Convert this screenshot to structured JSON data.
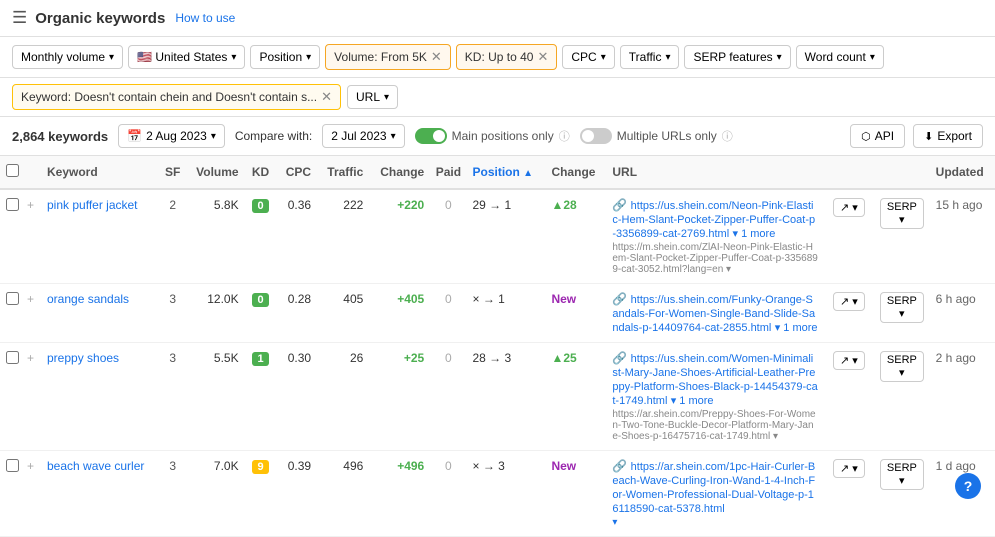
{
  "header": {
    "menu_icon": "≡",
    "title": "Organic keywords",
    "help_label": "How to use"
  },
  "filters": {
    "row1": [
      {
        "label": "Monthly volume",
        "type": "dropdown"
      },
      {
        "label": "United States",
        "type": "dropdown",
        "flag": "🇺🇸"
      },
      {
        "label": "Position",
        "type": "dropdown"
      },
      {
        "label": "Volume: From 5K",
        "type": "tag-active",
        "removable": true
      },
      {
        "label": "KD: Up to 40",
        "type": "tag-active",
        "removable": true
      },
      {
        "label": "CPC",
        "type": "dropdown"
      },
      {
        "label": "Traffic",
        "type": "dropdown"
      },
      {
        "label": "SERP features",
        "type": "dropdown"
      },
      {
        "label": "Word count",
        "type": "dropdown"
      }
    ],
    "row2": {
      "keyword_filter": "Keyword: Doesn't contain chein and Doesn't contain s...",
      "url_btn": "URL"
    }
  },
  "toolbar": {
    "keyword_count": "2,864 keywords",
    "calendar_icon": "📅",
    "date": "2 Aug 2023",
    "compare_label": "Compare with:",
    "compare_date": "2 Jul 2023",
    "main_positions_label": "Main positions only",
    "multiple_urls_label": "Multiple URLs only",
    "api_label": "API",
    "export_label": "Export"
  },
  "table": {
    "columns": [
      "Keyword",
      "SF",
      "Volume",
      "KD",
      "CPC",
      "Traffic",
      "Change",
      "Paid",
      "Position",
      "Change",
      "URL",
      "",
      "SERP",
      "Updated"
    ],
    "rows": [
      {
        "keyword": "pink puffer jacket",
        "sf": 2,
        "volume": "5.8K",
        "kd": "0",
        "kd_color": "green",
        "cpc": "0.36",
        "traffic": "222",
        "change": "+220",
        "change_dir": "pos",
        "paid": "0",
        "position_from": "29",
        "position_to": "1",
        "position_change": "▲28",
        "position_change_dir": "up",
        "url": "https://us.shein.com/Neon-Pink-Elastic-Hem-Slant-Pocket-Zipper-Puffer-Coat-p-335699-cat-2769.html",
        "url_display": "https://us.shein.com/Neon-Pink-Elastic-Hem-Slant-Pocket-Zipper-Puffer-Coat-p-3356899-cat-2769.html",
        "url_more": "1 more",
        "url_secondary": "https://m.shein.com/ZlAI-Neon-Pink-Elastic-Hem-Slant-Pocket-Zipper-Puffer-Coat-p-3356899-cat-3052.html?lang=en",
        "updated": "15 h ago"
      },
      {
        "keyword": "orange sandals",
        "sf": 3,
        "volume": "12.0K",
        "kd": "0",
        "kd_color": "green",
        "cpc": "0.28",
        "traffic": "405",
        "change": "+405",
        "change_dir": "pos",
        "paid": "0",
        "position_from": "×",
        "position_to": "1",
        "position_change": "New",
        "position_change_dir": "new",
        "url": "https://us.shein.com/Funky-Orange-Sandals-For-Women-Single-Band-Slide-Sandals-p-14409764-cat-2855.html",
        "url_display": "https://us.shein.com/Funky-Orange-Sandals-For-Women-Single-Band-Slide-Sandals-p-14409764-cat-2855.html",
        "url_more": "1 more",
        "url_secondary": "",
        "updated": "6 h ago"
      },
      {
        "keyword": "preppy shoes",
        "sf": 3,
        "volume": "5.5K",
        "kd": "1",
        "kd_color": "green",
        "cpc": "0.30",
        "traffic": "26",
        "change": "+25",
        "change_dir": "pos",
        "paid": "0",
        "position_from": "28",
        "position_to": "3",
        "position_change": "▲25",
        "position_change_dir": "up",
        "url": "https://us.shein.com/Women-Minimalist-Mary-Jane-Shoes-Artificial-Leather-Preppy-Platform-Shoes-Black-p-14454379-cat-1749.html",
        "url_display": "https://us.shein.com/Women-Minimalist-Mary-Jane-Shoes-Artificial-Leather-Preppy-Platform-Shoes-Black-p-14454379-cat-1749.html",
        "url_more": "1 more",
        "url_secondary": "https://ar.shein.com/Preppy-Shoes-For-Women-Two-Tone-Buckle-Decor-Platform-Mary-Jane-Shoes-p-16475716-cat-1749.html",
        "updated": "2 h ago"
      },
      {
        "keyword": "beach wave curler",
        "sf": 3,
        "volume": "7.0K",
        "kd": "9",
        "kd_color": "amber",
        "cpc": "0.39",
        "traffic": "496",
        "change": "+496",
        "change_dir": "pos",
        "paid": "0",
        "position_from": "×",
        "position_to": "3",
        "position_change": "New",
        "position_change_dir": "new",
        "url": "https://ar.shein.com/1pc-Hair-Curler-Beach-Wave-Curling-Iron-Wand-1-4-Inch-For-Women-Professional-Dual-Voltage-p-1611859 0-cat-5378.html",
        "url_display": "https://ar.shein.com/1pc-Hair-Curler-Beach-Wave-Curling-Iron-Wand-1-4-Inch-For-Women-Professional-Dual-Voltage-p-16118590-cat-5378.html",
        "url_more": "",
        "url_secondary": "",
        "updated": "1 d ago"
      }
    ]
  },
  "help_button": "?"
}
